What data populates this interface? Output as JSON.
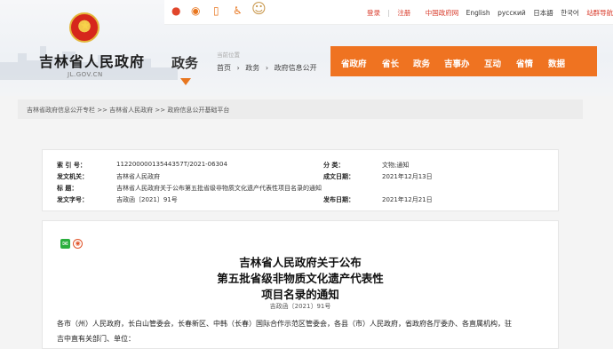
{
  "header": {
    "site_title": "吉林省人民政府",
    "site_domain": "JL.GOV.CN",
    "section_label": "政务"
  },
  "topbar": {
    "icons": [
      "weibo-icon",
      "weibo-alt-icon",
      "mobile-icon",
      "accessibility-icon",
      "mascot-icon"
    ],
    "login": "登录",
    "register": "注册",
    "languages": [
      "中国政府网",
      "English",
      "русский",
      "日本語",
      "한국어"
    ],
    "elder_mode": "站群导航"
  },
  "location": {
    "label": "当前位置",
    "items": [
      "首页",
      "›",
      "政务",
      "›",
      "政府信息公开"
    ]
  },
  "nav": {
    "items": [
      "省政府",
      "省长",
      "政务",
      "吉事办",
      "互动",
      "省情",
      "数据"
    ]
  },
  "breadcrumb": "吉林省政府信息公开专栏 >> 吉林省人民政府 >> 政府信息公开基础平台",
  "meta": {
    "index_label": "索 引 号：",
    "index_value": "11220000013544357T/2021-06304",
    "category_label": "分 类：",
    "category_value": "文物;通知",
    "issuer_label": "发文机关：",
    "issuer_value": "吉林省人民政府",
    "date_label": "成文日期：",
    "date_value": "2021年12月13日",
    "title_label": "标 题：",
    "title_value": "吉林省人民政府关于公布第五批省级非物质文化遗产代表性项目名录的通知",
    "doc_no_label": "发文字号：",
    "doc_no_value": "吉政函〔2021〕91号",
    "publish_label": "发布日期：",
    "publish_value": "2021年12月21日"
  },
  "document": {
    "title_lines": [
      "吉林省人民政府关于公布",
      "第五批省级非物质文化遗产代表性",
      "项目名录的通知"
    ],
    "doc_no": "吉政函〔2021〕91号",
    "body_lines": [
      "各市（州）人民政府，长白山管委会，长春新区、中韩（长春）国际合作示范区管委会，各县（市）人民政府，省政府各厅委办、各直属机构，驻",
      "吉中直有关部门、单位："
    ]
  },
  "colors": {
    "accent": "#ef7321",
    "link_red": "#d83a2a"
  }
}
